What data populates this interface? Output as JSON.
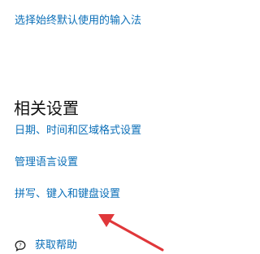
{
  "links": {
    "default_input": "选择始终默认使用的输入法",
    "date_time_region": "日期、时间和区域格式设置",
    "manage_language": "管理语言设置",
    "spelling_typing_keyboard": "拼写、键入和键盘设置"
  },
  "section": {
    "title": "相关设置"
  },
  "help": {
    "label": "获取帮助",
    "icon": "help-chat-icon"
  },
  "annotation": {
    "icon": "red-arrow-icon",
    "color": "#e0373a"
  },
  "colors": {
    "link": "#0b6fb8",
    "text": "#111111",
    "background": "#ffffff"
  }
}
